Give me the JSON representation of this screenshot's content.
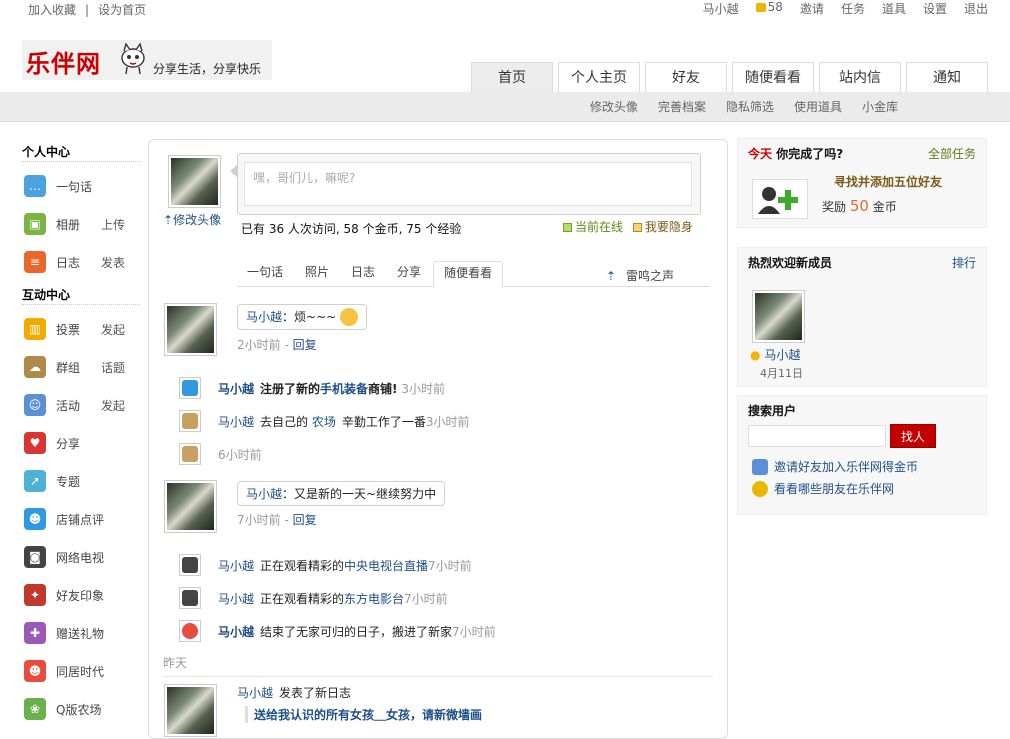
{
  "topbar": {
    "left": [
      "加入收藏",
      "设为首页"
    ],
    "user": "马小越",
    "coins": "58",
    "links": [
      "邀请",
      "任务",
      "道具",
      "设置",
      "退出"
    ]
  },
  "logo": {
    "text": "乐伴网",
    "slogan": "分享生活，分享快乐"
  },
  "nav": {
    "tabs": [
      "首页",
      "个人主页",
      "好友",
      "随便看看",
      "站内信",
      "通知"
    ]
  },
  "subnav": {
    "items": [
      "修改头像",
      "完善档案",
      "隐私筛选",
      "使用道具",
      "小金库"
    ]
  },
  "left": {
    "personal_title": "个人中心",
    "personal": [
      {
        "label": "一句话",
        "action": ""
      },
      {
        "label": "相册",
        "action": "上传"
      },
      {
        "label": "日志",
        "action": "发表"
      }
    ],
    "interact_title": "互动中心",
    "interact": [
      {
        "label": "投票",
        "action": "发起"
      },
      {
        "label": "群组",
        "action": "话题"
      },
      {
        "label": "活动",
        "action": "发起"
      },
      {
        "label": "分享",
        "action": ""
      },
      {
        "label": "专题",
        "action": ""
      },
      {
        "label": "店铺点评",
        "action": ""
      },
      {
        "label": "网络电视",
        "action": ""
      },
      {
        "label": "好友印象",
        "action": ""
      },
      {
        "label": "赠送礼物",
        "action": ""
      },
      {
        "label": "同居时代",
        "action": ""
      },
      {
        "label": "Q版农场",
        "action": ""
      }
    ]
  },
  "publish": {
    "edit_avatar": "修改头像",
    "placeholder": "嘿，哥们儿，嘛呢?",
    "stats": "已有  36 人次访问, 58 个金币, 75 个经验",
    "online": "当前在线",
    "hide": "我要隐身"
  },
  "feed_tabs": {
    "tabs": [
      "一句话",
      "照片",
      "日志",
      "分享",
      "随便看看"
    ],
    "right": "雷鸣之声"
  },
  "feed": {
    "post1": {
      "name": "马小越",
      "text": "：烦~~~",
      "time": "2小时前",
      "reply": "回复"
    },
    "rows1": [
      {
        "name": "马小越",
        "pre": "注册了新的",
        "link": "手机装备",
        "post": "商铺!",
        "time": "3小时前"
      },
      {
        "name": "马小越",
        "pre": "去自己的",
        "link": "农场",
        "post": "辛勤工作了一番",
        "time": "3小时前"
      },
      {
        "name": "",
        "pre": "",
        "link": "",
        "post": "",
        "time": "6小时前"
      }
    ],
    "post2": {
      "name": "马小越",
      "text": "：又是新的一天~继续努力中",
      "time": "7小时前",
      "reply": "回复"
    },
    "rows2": [
      {
        "name": "马小越",
        "pre": "正在观看精彩的",
        "link": "中央电视台直播",
        "post": "",
        "time": "7小时前"
      },
      {
        "name": "马小越",
        "pre": "正在观看精彩的",
        "link": "东方电影台",
        "post": "",
        "time": "7小时前"
      },
      {
        "name": "马小越",
        "pre": "结束了无家可归的日子，搬进了新家",
        "link": "",
        "post": "",
        "time": "7小时前"
      }
    ],
    "yesterday": "昨天",
    "post3": {
      "name": "马小越",
      "text": "发表了新日志",
      "title": "送给我认识的所有女孩＿女孩，请新微墙画"
    }
  },
  "right": {
    "task": {
      "today": "今天",
      "question": "你完成了吗?",
      "all": "全部任务",
      "name": "寻找并添加五位好友",
      "reward_label": "奖励",
      "reward": "50",
      "unit": "金币"
    },
    "new_members": {
      "title": "热烈欢迎新成员",
      "rank": "排行",
      "name": "马小越",
      "date": "4月11日"
    },
    "search": {
      "title": "搜索用户",
      "button": "找人",
      "invite": "邀请好友加入乐伴网得金币",
      "find": "看看哪些朋友在乐伴网"
    }
  }
}
